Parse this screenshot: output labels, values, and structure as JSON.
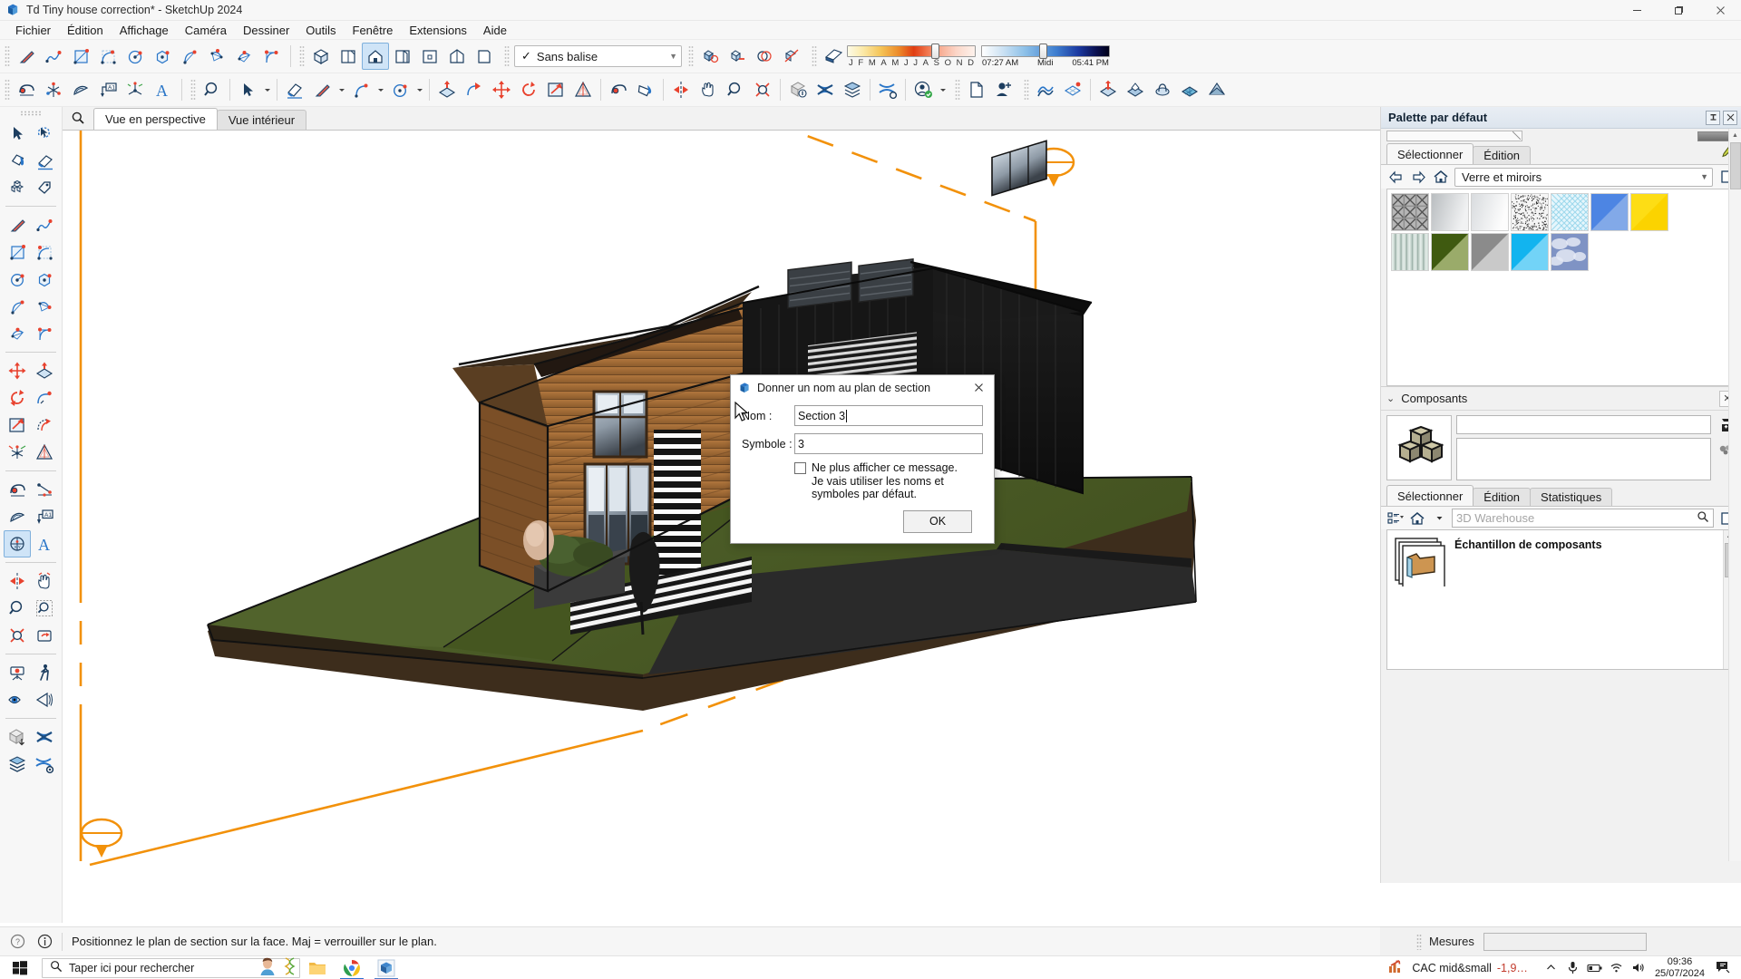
{
  "window": {
    "title": "Td Tiny house correction* - SketchUp 2024",
    "app_icon": "sketchup-logo-icon",
    "minimize": "—",
    "maximize": "❐",
    "close": "✕"
  },
  "menubar": {
    "items": [
      {
        "label": "Fichier"
      },
      {
        "label": "Édition"
      },
      {
        "label": "Affichage"
      },
      {
        "label": "Caméra"
      },
      {
        "label": "Dessiner"
      },
      {
        "label": "Outils"
      },
      {
        "label": "Fenêtre"
      },
      {
        "label": "Extensions"
      },
      {
        "label": "Aide"
      }
    ]
  },
  "toolbar": {
    "tag_selector": {
      "check": "✓",
      "label": "Sans balise",
      "caret": "▼"
    },
    "shadow": {
      "months": [
        "J",
        "F",
        "M",
        "A",
        "M",
        "J",
        "J",
        "A",
        "S",
        "O",
        "N",
        "D"
      ],
      "month_thumb_pct": 68,
      "time_start": "07:27 AM",
      "time_noon": "Midi",
      "time_end": "05:41 PM",
      "time_thumb_pct": 48
    }
  },
  "view_tabs": {
    "search_icon": "magnifier-icon",
    "tabs": [
      {
        "label": "Vue en perspective",
        "active": true
      },
      {
        "label": "Vue intérieur",
        "active": false
      }
    ]
  },
  "tray": {
    "title": "Palette par défaut",
    "pin_icon": "pin-icon",
    "close_icon": "close-icon",
    "materials": {
      "tabs": [
        {
          "label": "Sélectionner",
          "active": true
        },
        {
          "label": "Édition",
          "active": false
        }
      ],
      "eyedropper_icon": "eyedropper-icon",
      "back_icon": "arrow-left-icon",
      "forward_icon": "arrow-right-icon",
      "home_icon": "home-icon",
      "details_icon": "details-icon",
      "collection": "Verre et miroirs",
      "caret": "▼",
      "swatches": [
        {
          "name": "mesh-tile",
          "kind": "mesh"
        },
        {
          "name": "mirror-grey",
          "kind": "grad",
          "c1": "#b9bdc0",
          "c2": "#f1f2f3"
        },
        {
          "name": "glass-white",
          "kind": "grad",
          "c1": "#d8dbde",
          "c2": "#fdfdfd"
        },
        {
          "name": "noise-speckle",
          "kind": "noise"
        },
        {
          "name": "glass-diamond",
          "kind": "diamond"
        },
        {
          "name": "glass-blue",
          "kind": "tri",
          "c1": "#4d85e3",
          "c2": "#82a9e8"
        },
        {
          "name": "glass-yellow",
          "kind": "tri",
          "c1": "#fddd15",
          "c2": "#fbd300"
        },
        {
          "name": "glass-corrugated",
          "kind": "stripes"
        },
        {
          "name": "glass-olive",
          "kind": "tri",
          "c1": "#3f5a10",
          "c2": "#9aab6a"
        },
        {
          "name": "glass-grey",
          "kind": "tri",
          "c1": "#8b8b8b",
          "c2": "#c9c9c9"
        },
        {
          "name": "glass-cyan",
          "kind": "tri",
          "c1": "#12b4ef",
          "c2": "#72d3f7"
        },
        {
          "name": "glass-sky",
          "kind": "clouds"
        }
      ]
    },
    "components": {
      "section_title": "Composants",
      "collapse_icon": "chevron-down-icon",
      "close_icon": "close-icon",
      "thumb_icon": "components-cubes-icon",
      "name_value": "",
      "description_value": "",
      "tabs": [
        {
          "label": "Sélectionner",
          "active": true
        },
        {
          "label": "Édition",
          "active": false
        },
        {
          "label": "Statistiques",
          "active": false
        }
      ],
      "view_icon": "list-view-icon",
      "home_icon": "home-icon",
      "dropdown_icon": "caret-down-icon",
      "search_placeholder": "3D Warehouse",
      "search_icon": "magnifier-icon",
      "details_icon": "details-icon",
      "results": [
        {
          "label": "Échantillon de composants",
          "icon": "folder-icon"
        }
      ]
    }
  },
  "measurements": {
    "label": "Mesures",
    "value": ""
  },
  "statusbar": {
    "help_icon": "question-circle-icon",
    "info_icon": "info-circle-icon",
    "message": "Positionnez le plan de section sur la face.  Maj = verrouiller sur le plan."
  },
  "taskbar": {
    "start_icon": "windows-start-icon",
    "search_placeholder": "Taper ici pour rechercher",
    "search_icon": "magnifier-icon",
    "widget_icons": [
      "person-avatar-icon",
      "dna-helix-icon"
    ],
    "apps": [
      {
        "name": "file-explorer-icon",
        "active": false
      },
      {
        "name": "chrome-icon",
        "active": true
      },
      {
        "name": "sketchup-icon",
        "active": true
      }
    ],
    "tray": {
      "stock_icon": "stock-chart-icon",
      "stock_name": "CAC mid&small",
      "stock_value": "-1,9…",
      "chevron": "⌃",
      "icons": [
        "microphone-icon",
        "battery-icon",
        "wifi-icon",
        "volume-icon"
      ],
      "time": "09:36",
      "date": "25/07/2024",
      "notification_icon": "notifications-icon"
    }
  },
  "dialog": {
    "icon": "sketchup-logo-icon",
    "title": "Donner un nom au plan de section",
    "close": "✕",
    "fields": [
      {
        "label": "Nom :",
        "value": "Section 3",
        "name": "nom"
      },
      {
        "label": "Symbole :",
        "value": "3",
        "name": "symbole"
      }
    ],
    "checkbox": {
      "checked": false,
      "text": "Ne plus afficher ce message.  Je vais utiliser les noms et symboles par défaut."
    },
    "ok_label": "OK"
  },
  "model": {
    "section_plane_color": "#f2910a",
    "ground_green": "#4a5a25",
    "ground_dark": "#3b2d1e",
    "wood_color": "#9a6230",
    "dark_cladding": "#161616"
  }
}
